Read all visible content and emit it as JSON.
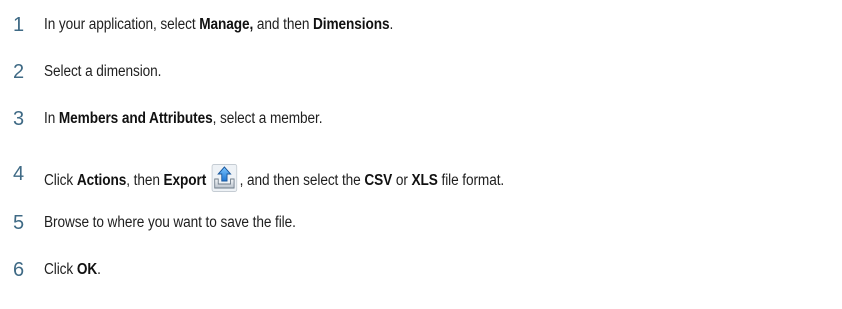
{
  "steps": [
    {
      "number": "1",
      "parts": [
        "In your application, select ",
        "Manage,",
        " and then ",
        "Dimensions",
        "."
      ]
    },
    {
      "number": "2",
      "parts": [
        "Select a dimension."
      ]
    },
    {
      "number": "3",
      "parts": [
        "In ",
        "Members and Attributes",
        ", select a member."
      ]
    },
    {
      "number": "4",
      "parts": [
        "Click ",
        "Actions",
        ", then ",
        "Export",
        ", and then select the ",
        "CSV",
        " or ",
        "XLS",
        " file format."
      ],
      "icon": "export-icon"
    },
    {
      "number": "5",
      "parts": [
        "Browse to where you want to save the file."
      ]
    },
    {
      "number": "6",
      "parts": [
        "Click ",
        "OK",
        "."
      ]
    }
  ],
  "colors": {
    "number": "#3f6a85",
    "text": "#1f1f1f"
  }
}
